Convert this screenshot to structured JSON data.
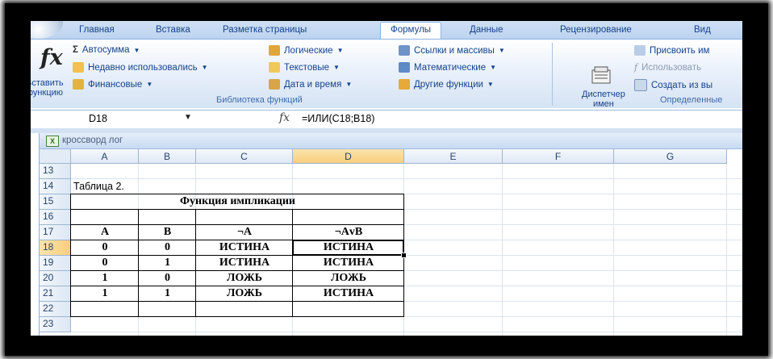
{
  "ribbon": {
    "tabs": [
      "Главная",
      "Вставка",
      "Разметка страницы",
      "Формулы",
      "Данные",
      "Рецензирование",
      "Вид"
    ],
    "active_tab": "Формулы",
    "insert_function_label_1": "Вставить",
    "insert_function_label_2": "функцию",
    "function_library": {
      "label": "Библиотека функций",
      "autosum": "Автосумма",
      "recently_used": "Недавно использовались",
      "financial": "Финансовые",
      "logical": "Логические",
      "text": "Текстовые",
      "date_time": "Дата и время",
      "lookup": "Ссылки и массивы",
      "math": "Математические",
      "other": "Другие функции"
    },
    "defined_names": {
      "label": "Определенные",
      "name_manager_1": "Диспетчер",
      "name_manager_2": "имен",
      "assign_name": "Присвоить им",
      "use_in_formula": "Использовать",
      "create_from_selection": "Создать из вы"
    }
  },
  "formula_bar": {
    "name_box": "D18",
    "fx": "fx",
    "formula": "=ИЛИ(С18;В18)"
  },
  "workbook": {
    "title": "кроссворд лог",
    "columns": [
      "A",
      "B",
      "C",
      "D",
      "E",
      "F",
      "G"
    ],
    "rows": [
      "13",
      "14",
      "15",
      "16",
      "17",
      "18",
      "19",
      "20",
      "21",
      "22",
      "23"
    ],
    "selected_cell": "D18",
    "caption": "Таблица 2.",
    "table_title": "Функция импликации",
    "table_header": [
      "А",
      "В",
      "¬А",
      "¬АvВ"
    ],
    "table_rows": [
      [
        "0",
        "0",
        "ИСТИНА",
        "ИСТИНА"
      ],
      [
        "0",
        "1",
        "ИСТИНА",
        "ИСТИНА"
      ],
      [
        "1",
        "0",
        "ЛОЖЬ",
        "ЛОЖЬ"
      ],
      [
        "1",
        "1",
        "ЛОЖЬ",
        "ИСТИНА"
      ]
    ]
  },
  "colors": {
    "ribbon_text": "#15428b",
    "header_selected": "#f8ce7d",
    "frame": "#000000"
  }
}
